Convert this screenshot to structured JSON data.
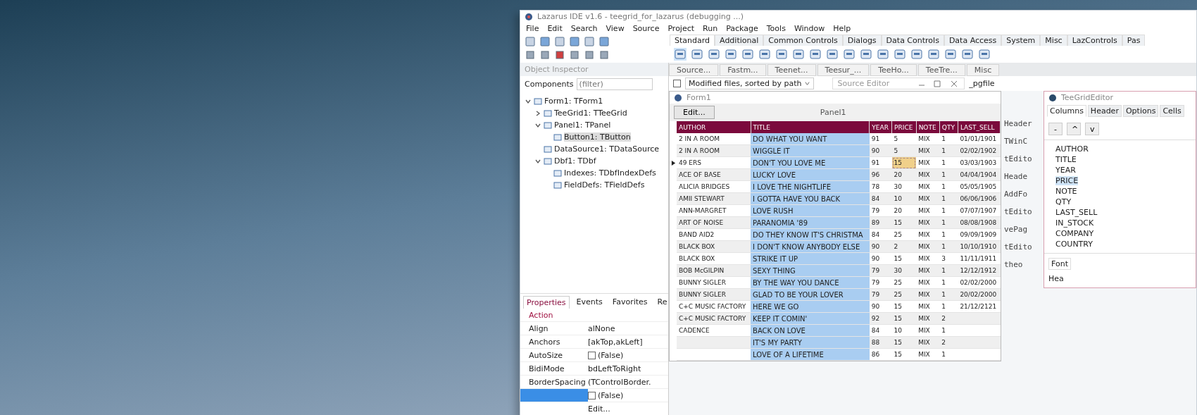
{
  "window": {
    "title": "Lazarus IDE v1.6 - teegrid_for_lazarus (debugging ...)"
  },
  "menu": [
    "File",
    "Edit",
    "Search",
    "View",
    "Source",
    "Project",
    "Run",
    "Package",
    "Tools",
    "Window",
    "Help"
  ],
  "palette_tabs": [
    {
      "label": "Standard",
      "selected": true
    },
    {
      "label": "Additional",
      "selected": false
    },
    {
      "label": "Common Controls",
      "selected": false
    },
    {
      "label": "Dialogs",
      "selected": false
    },
    {
      "label": "Data Controls",
      "selected": false
    },
    {
      "label": "Data Access",
      "selected": false
    },
    {
      "label": "System",
      "selected": false
    },
    {
      "label": "Misc",
      "selected": false
    },
    {
      "label": "LazControls",
      "selected": false
    },
    {
      "label": "Pas",
      "selected": false
    }
  ],
  "editor_tabs": [
    "Source...",
    "Fastm...",
    "Teenet...",
    "Teesur_...",
    "TeeHo...",
    "TeeTre...",
    "Misc"
  ],
  "modified_files": {
    "checked": false,
    "value": "Modified files, sorted by path"
  },
  "object_inspector": {
    "title": "Object Inspector",
    "components_label": "Components",
    "filter_placeholder": "(filter)",
    "tree": [
      {
        "label": "Form1: TForm1",
        "selected": false,
        "expanded": true,
        "children": [
          {
            "label": "TeeGrid1: TTeeGrid",
            "selected": false,
            "expanded": false
          },
          {
            "label": "Panel1: TPanel",
            "selected": false,
            "expanded": true,
            "children": [
              {
                "label": "Button1: TButton",
                "selected": true
              }
            ]
          },
          {
            "label": "DataSource1: TDataSource",
            "selected": false
          },
          {
            "label": "Dbf1: TDbf",
            "selected": false,
            "expanded": true,
            "children": [
              {
                "label": "Indexes: TDbfIndexDefs",
                "selected": false
              },
              {
                "label": "FieldDefs: TFieldDefs",
                "selected": false
              }
            ]
          }
        ]
      }
    ],
    "tabs": [
      {
        "label": "Properties",
        "selected": true
      },
      {
        "label": "Events",
        "selected": false
      },
      {
        "label": "Favorites",
        "selected": false
      },
      {
        "label": "Re",
        "selected": false
      }
    ],
    "properties": [
      {
        "name": "Action",
        "selected": false
      },
      {
        "name": "Align",
        "value": "alNone",
        "selected": false
      },
      {
        "name": "Anchors",
        "value": "[akTop,akLeft]",
        "selected": false
      },
      {
        "name": "AutoSize",
        "value": "(False)",
        "kind": "check",
        "checked": false,
        "selected": false
      },
      {
        "name": "BidiMode",
        "value": "bdLeftToRight",
        "selected": false
      },
      {
        "name": "BorderSpacing",
        "value": "(TControlBorder.",
        "selected": false
      },
      {
        "value": "(False)",
        "kind": "check",
        "checked": false,
        "selected": true
      },
      {
        "value": "Edit...",
        "selected": false
      }
    ]
  },
  "source_editor": {
    "title": "Source Editor",
    "tab": "_pgfile"
  },
  "form": {
    "title": "Form1",
    "button": "Edit...",
    "panel": "Panel1",
    "columns": [
      {
        "label": "AUTHOR",
        "selected": false
      },
      {
        "label": "TITLE",
        "selected": true
      },
      {
        "label": "YEAR",
        "selected": false
      },
      {
        "label": "PRICE",
        "selected": false
      },
      {
        "label": "NOTE",
        "selected": false
      },
      {
        "label": "QTY",
        "selected": false
      },
      {
        "label": "LAST_SELL",
        "selected": false
      }
    ],
    "rows": [
      {
        "cells": [
          "2 IN A ROOM",
          "DO WHAT YOU WANT",
          "91",
          "5",
          "MIX",
          "1",
          "01/01/1901"
        ],
        "current": false
      },
      {
        "cells": [
          "2 IN A ROOM",
          "WIGGLE IT",
          "90",
          "5",
          "MIX",
          "1",
          "02/02/1902"
        ],
        "current": false
      },
      {
        "cells": [
          "49 ERS",
          "DON'T YOU LOVE ME",
          "91",
          "15",
          "MIX",
          "1",
          "03/03/1903"
        ],
        "current": true
      },
      {
        "cells": [
          "ACE OF BASE",
          "LUCKY LOVE",
          "96",
          "20",
          "MIX",
          "1",
          "04/04/1904"
        ],
        "current": false
      },
      {
        "cells": [
          "ALICIA BRIDGES",
          "I LOVE THE NIGHTLIFE",
          "78",
          "30",
          "MIX",
          "1",
          "05/05/1905"
        ],
        "current": false
      },
      {
        "cells": [
          "AMII STEWART",
          "I GOTTA HAVE YOU BACK",
          "84",
          "10",
          "MIX",
          "1",
          "06/06/1906"
        ],
        "current": false
      },
      {
        "cells": [
          "ANN-MARGRET",
          "LOVE RUSH",
          "79",
          "20",
          "MIX",
          "1",
          "07/07/1907"
        ],
        "current": false
      },
      {
        "cells": [
          "ART OF NOISE",
          "PARANOMIA '89",
          "89",
          "15",
          "MIX",
          "1",
          "08/08/1908"
        ],
        "current": false
      },
      {
        "cells": [
          "BAND AID2",
          "DO THEY KNOW IT'S CHRISTMA",
          "84",
          "25",
          "MIX",
          "1",
          "09/09/1909"
        ],
        "current": false
      },
      {
        "cells": [
          "BLACK BOX",
          "I DON'T KNOW ANYBODY ELSE",
          "90",
          "2",
          "MIX",
          "1",
          "10/10/1910"
        ],
        "current": false
      },
      {
        "cells": [
          "BLACK BOX",
          "STRIKE IT UP",
          "90",
          "15",
          "MIX",
          "3",
          "11/11/1911"
        ],
        "current": false
      },
      {
        "cells": [
          "BOB McGILPIN",
          "SEXY THING",
          "79",
          "30",
          "MIX",
          "1",
          "12/12/1912"
        ],
        "current": false
      },
      {
        "cells": [
          "BUNNY SIGLER",
          "BY THE WAY YOU DANCE",
          "79",
          "25",
          "MIX",
          "1",
          "02/02/2000"
        ],
        "current": false
      },
      {
        "cells": [
          "BUNNY SIGLER",
          "GLAD TO BE YOUR LOVER",
          "79",
          "25",
          "MIX",
          "1",
          "20/02/2000"
        ],
        "current": false
      },
      {
        "cells": [
          "C+C MUSIC FACTORY",
          "HERE WE GO",
          "90",
          "15",
          "MIX",
          "1",
          "21/12/2121"
        ],
        "current": false
      },
      {
        "cells": [
          "C+C MUSIC FACTORY",
          "KEEP IT COMIN'",
          "92",
          "15",
          "MIX",
          "2"
        ],
        "current": false
      },
      {
        "cells": [
          "CADENCE",
          "BACK ON LOVE",
          "84",
          "10",
          "MIX",
          "1"
        ],
        "current": false
      },
      {
        "cells": {
          "title": "IT'S MY PARTY",
          "year": "88",
          "price": "15",
          "note": "MIX",
          "qty": "2"
        },
        "current": false
      },
      {
        "cells": {
          "title": "LOVE OF A LIFETIME",
          "year": "86",
          "price": "15",
          "note": "MIX",
          "qty": "1"
        },
        "current": false
      }
    ]
  },
  "code_fragments": [
    "Header",
    "TWinC",
    "tEdito",
    "Heade",
    "AddFo",
    "tEdito",
    "vePag",
    "tEdito",
    "theo"
  ],
  "grid_editor": {
    "title": "TeeGridEditor",
    "tabs": [
      {
        "label": "Columns",
        "selected": true
      },
      {
        "label": "Header",
        "selected": false
      },
      {
        "label": "Options",
        "selected": false
      },
      {
        "label": "Cells",
        "selected": false
      }
    ],
    "buttons": [
      "-",
      "^",
      "v"
    ],
    "fields": [
      {
        "label": "AUTHOR",
        "selected": false
      },
      {
        "label": "TITLE",
        "selected": false
      },
      {
        "label": "YEAR",
        "selected": false
      },
      {
        "label": "PRICE",
        "selected": true
      },
      {
        "label": "NOTE",
        "selected": false
      },
      {
        "label": "QTY",
        "selected": false
      },
      {
        "label": "LAST_SELL",
        "selected": false
      },
      {
        "label": "IN_STOCK",
        "selected": false
      },
      {
        "label": "COMPANY",
        "selected": false
      },
      {
        "label": "COUNTRY",
        "selected": false
      }
    ],
    "lower_tab": "Font",
    "lower_label": "Hea"
  }
}
